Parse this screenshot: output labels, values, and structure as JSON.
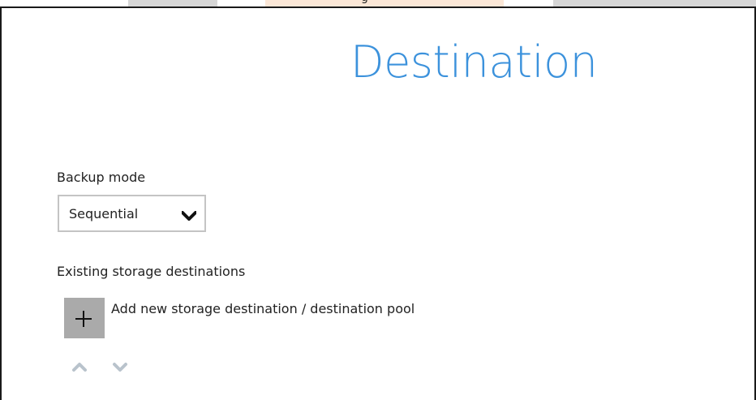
{
  "tabs": [
    {
      "label": ""
    },
    {
      "label": "g"
    },
    {
      "label": ""
    }
  ],
  "page": {
    "title": "Destination"
  },
  "backup_mode": {
    "label": "Backup mode",
    "selected": "Sequential"
  },
  "storage": {
    "section_label": "Existing storage destinations",
    "add_label": "Add new storage destination / destination pool"
  },
  "colors": {
    "title": "#3c92dc",
    "add_button": "#aaaaaa",
    "arrows": "#b9c3cc",
    "active_tab": "#fbe7d7"
  }
}
